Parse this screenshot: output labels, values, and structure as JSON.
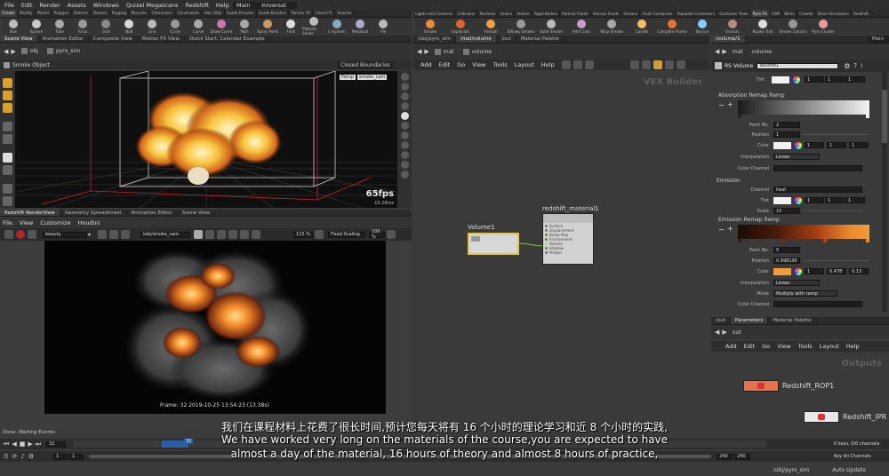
{
  "menubar": {
    "items": [
      "File",
      "Edit",
      "Render",
      "Assets",
      "Windows",
      "Quixel Megascans",
      "Redshift",
      "Help"
    ],
    "desktop": "Universal",
    "desktop_right": "Main"
  },
  "shelf_tabs_left": [
    "Create",
    "Modify",
    "Model",
    "Polygon",
    "Deform",
    "Texture",
    "Rigging",
    "Muscles",
    "Characters",
    "Constraints",
    "Hair Utils",
    "Guide Process",
    "Guide Brushes",
    "Terrain FX",
    "Cloud FX",
    "Volume"
  ],
  "shelf_tabs_right": [
    "Lights and Cameras",
    "Collisions",
    "Particles",
    "Grains",
    "Vellum",
    "Rigid Bodies",
    "Particle Fluids",
    "Viscous Fluids",
    "Oceans",
    "Fluid Containers",
    "Populate Containers",
    "Container Tools",
    "Pyro FX",
    "FEM",
    "Wires",
    "Crowds",
    "Drive Simulation",
    "Redshift"
  ],
  "shelf_tools_left": [
    "Box",
    "Sphere",
    "Tube",
    "Torus",
    "Grid",
    "Null",
    "Line",
    "Circle",
    "Curve",
    "Draw Curve",
    "Path",
    "Spray Paint",
    "Font",
    "Platonic Solids",
    "L-System",
    "Metaball",
    "File"
  ],
  "shelf_tools_right": [
    "Smoke",
    "Explosion",
    "Fireball",
    "Billowy Smoke",
    "Solid Smoke",
    "Add Color",
    "Wisp Smoke",
    "Candle",
    "Campfire Flame",
    "Sky Ice",
    "Erosion",
    "Nuake Trail",
    "Smoke Column",
    "Pyro Cluster"
  ],
  "viewport": {
    "tabs": [
      "Scene View",
      "Animation Editor",
      "Composite View",
      "Motion FX View",
      "Quick Start: Calendar Example"
    ],
    "path_obj": "obj",
    "path_sim": "pyro_sim",
    "object_label": "Smoke Object",
    "closed_boundaries": "Closed Boundaries",
    "persp": "Persp",
    "camera": "smoke_cam",
    "fps": "65fps",
    "ms": "15.28ms"
  },
  "renderview": {
    "tabs": [
      "Redshift RenderView",
      "Geometry Spreadsheet",
      "Animation Editor",
      "Scene View"
    ],
    "menu": [
      "File",
      "View",
      "Customize",
      "Houdini"
    ],
    "aov": "beauty",
    "camera_path": "/obj/smoke_cam",
    "zoom": "115 %",
    "scaling": "Fixed Scaling",
    "zoom2": "100 %",
    "frame_info": "Frame: 32   2019-10-25  13:54:23  (13.38s)"
  },
  "vex": {
    "path_tabs": [
      "/obj/pyro_sim",
      "/mat/volume",
      "/out",
      "Material Palette"
    ],
    "crumbs": [
      "mat",
      "volume"
    ],
    "menu": [
      "Add",
      "Edit",
      "Go",
      "View",
      "Tools",
      "Layout",
      "Help"
    ],
    "title": "VEX Builder",
    "node_volume": "Volume1",
    "node_material": "redshift_material1",
    "node_material_ports": [
      "Surface",
      "Displacement",
      "Bump Map",
      "Environment",
      "Volume",
      "Shadow",
      "Photon"
    ]
  },
  "params": {
    "tabs": [
      "/volume/1",
      "Main"
    ],
    "node_type": "RS Volume",
    "node_name": "Volume1",
    "tint_label": "Tint",
    "tint_values": [
      "1",
      "1",
      "1"
    ],
    "absorption_ramp": "Absorption Remap Ramp",
    "point_no_label": "Point No.",
    "point_no": "2",
    "position_label": "Position",
    "position": "1",
    "color_label": "Color",
    "color_values": [
      "1",
      "1",
      "1"
    ],
    "interp_label": "Interpolation",
    "interp": "Linear",
    "color_channel_label": "Color Channel",
    "emission_header": "Emission",
    "channel_label": "Channel",
    "channel": "heat",
    "em_tint_label": "Tint",
    "em_tint_values": [
      "1",
      "1",
      "1"
    ],
    "scale_label": "Scale",
    "scale": "10",
    "emission_ramp": "Emission Remap Ramp",
    "em_point_no": "5",
    "em_position": "0.998195",
    "em_color_values": [
      "1",
      "0.478",
      "0.13"
    ],
    "em_interp": "Linear",
    "mode_label": "Mode",
    "mode": "Multiply with ramp",
    "em_color_channel_label": "Color Channel"
  },
  "out_net": {
    "tabs": [
      "/out",
      "Parameters",
      "Material Palette"
    ],
    "crumb": "out",
    "menu": [
      "Add",
      "Edit",
      "Go",
      "View",
      "Tools",
      "Layout",
      "Help"
    ],
    "title": "Outputs",
    "node1": "Redshift_ROP1",
    "node2": "Redshift_IPR"
  },
  "timeline": {
    "status": "Done. Waiting Events",
    "frame": "32",
    "frame_marker": "32",
    "start": "1",
    "start2": "1",
    "end": "240",
    "end2": "240",
    "keys": "0 keys, 0/0 channels",
    "all_channels": "Key All Channels",
    "path": "/obj/pyro_sim",
    "auto_update": "Auto Update"
  },
  "subtitle": {
    "cn": "我们在课程材料上花费了很长时间,预计您每天将有 16 个小时的理论学习和近 8 个小时的实践,",
    "en1": "We have worked very long on the materials of the course,you are expected to have",
    "en2": "almost a day of the material, 16 hours of theory and almost 8 hours of practice,"
  },
  "colors": {
    "accent_orange": "#e98a2e",
    "node_selected": "#e6c542",
    "rop_orange": "#e8734a",
    "ipr_red": "#d9323a"
  }
}
